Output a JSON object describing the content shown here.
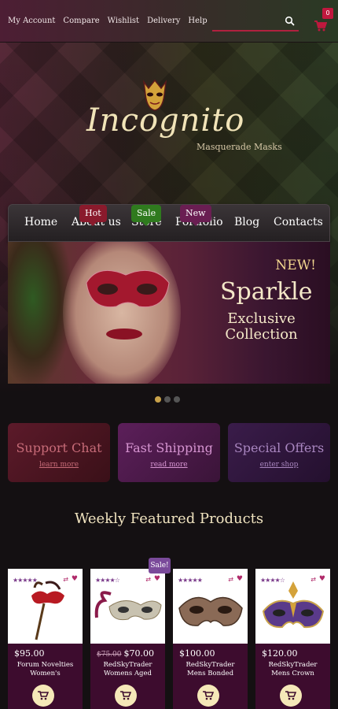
{
  "topbar": {
    "links": [
      "My Account",
      "Compare",
      "Wishlist",
      "Delivery",
      "Help"
    ],
    "cart_count": "0",
    "search_placeholder": ""
  },
  "logo": {
    "name": "Incognito",
    "tagline": "Masquerade Masks"
  },
  "nav": {
    "items": [
      {
        "label": "Home",
        "badge": ""
      },
      {
        "label": "About us",
        "badge": "Hot"
      },
      {
        "label": "Store",
        "badge": "Sale"
      },
      {
        "label": "Portfolio",
        "badge": "New"
      },
      {
        "label": "Blog",
        "badge": ""
      },
      {
        "label": "Contacts",
        "badge": ""
      }
    ]
  },
  "slider": {
    "badge": "NEW!",
    "headline": "Sparkle",
    "subline1": "Exclusive",
    "subline2": "Collection",
    "dots": 3,
    "active_dot": 1
  },
  "promos": [
    {
      "title": "Support Chat",
      "link": "learn more"
    },
    {
      "title": "Fast Shipping",
      "link": "read more"
    },
    {
      "title": "Special Offers",
      "link": "enter shop"
    }
  ],
  "featured": {
    "title": "Weekly Featured Products",
    "sale_badge": "Sale!",
    "products": [
      {
        "price": "$95.00",
        "old_price": "",
        "name1": "Forum Novelties",
        "name2": "Women's",
        "stars": "★★★★★"
      },
      {
        "price": "$70.00",
        "old_price": "$75.00",
        "name1": "RedSkyTrader",
        "name2": "Womens Aged",
        "stars": "★★★★☆"
      },
      {
        "price": "$100.00",
        "old_price": "",
        "name1": "RedSkyTrader",
        "name2": "Mens Bonded",
        "stars": "★★★★★"
      },
      {
        "price": "$120.00",
        "old_price": "",
        "name1": "RedSkyTrader",
        "name2": "Mens Crown",
        "stars": "★★★★☆"
      }
    ]
  },
  "colors": {
    "accent": "#b0213f",
    "gold": "#f1e4b8",
    "product_bg": "#3d0c2e"
  }
}
